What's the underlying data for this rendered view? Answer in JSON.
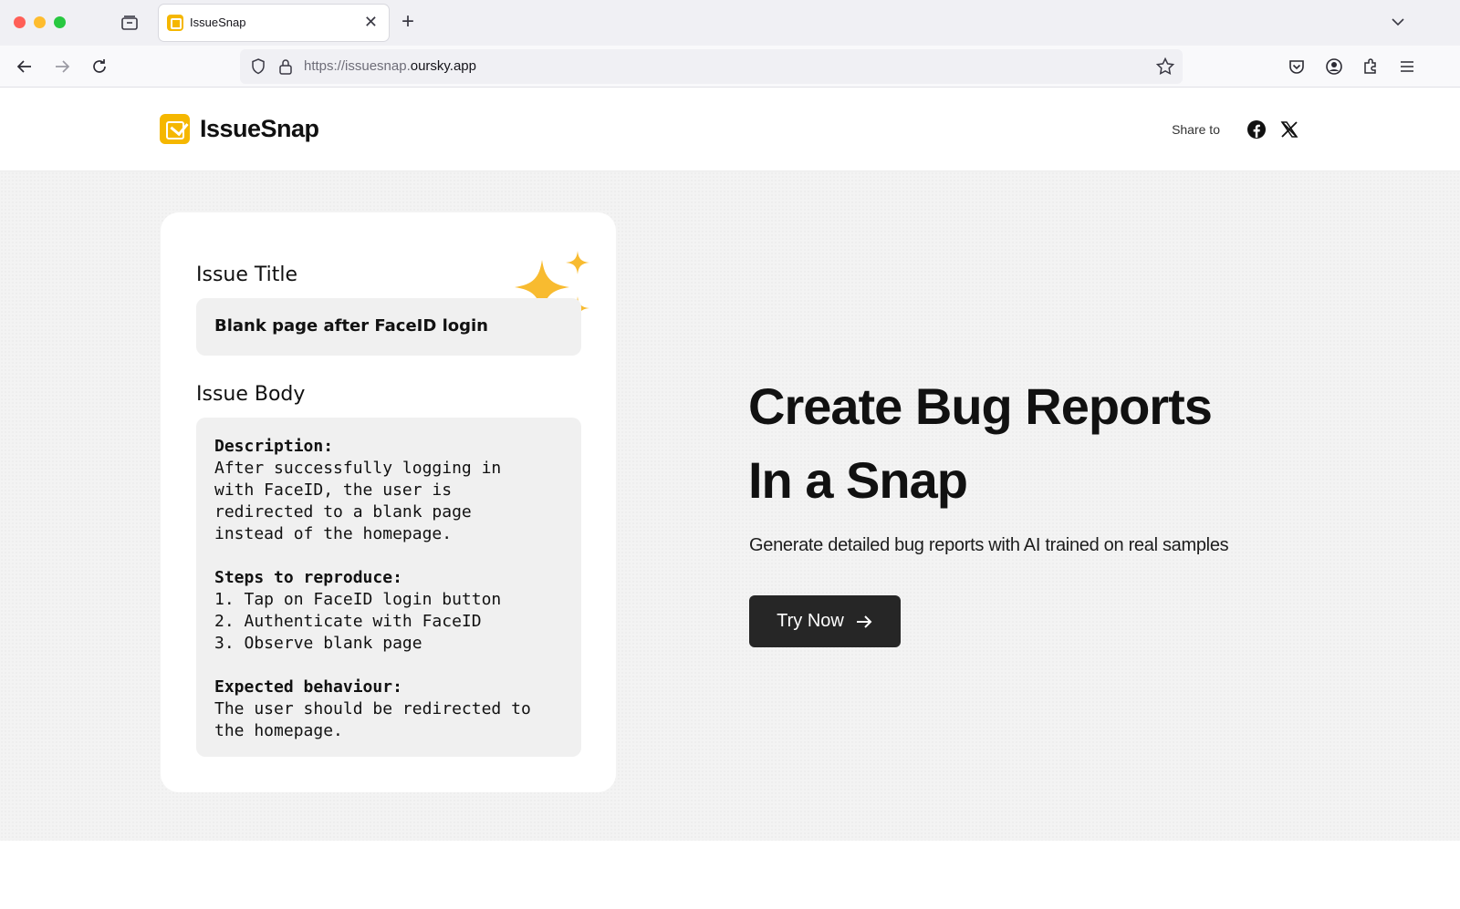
{
  "browser": {
    "tab_title": "IssueSnap",
    "tab_close": "✕",
    "new_tab": "+",
    "url_prefix": "https://issuesnap.",
    "url_domain": "oursky.app"
  },
  "header": {
    "logo_text": "IssueSnap",
    "share_label": "Share to",
    "share_targets": [
      "facebook-icon",
      "x-icon"
    ]
  },
  "card": {
    "title_label": "Issue Title",
    "title_value": "Blank page after FaceID login",
    "body_label": "Issue Body",
    "sections": [
      {
        "heading": "Description:",
        "lines": [
          "After successfully logging in",
          "with FaceID, the user is",
          "redirected to a blank page",
          "instead of the homepage."
        ]
      },
      {
        "heading": "Steps to reproduce:",
        "lines": [
          "1. Tap on FaceID login button",
          "2. Authenticate with FaceID",
          "3. Observe blank page"
        ]
      },
      {
        "heading": "Expected behaviour:",
        "lines": [
          "The user should be redirected to",
          "the homepage."
        ]
      }
    ]
  },
  "hero": {
    "headline_line1": "Create Bug Reports",
    "headline_line2": "In a Snap",
    "subline": "Generate detailed bug reports with AI trained on real samples",
    "cta_label": "Try Now"
  },
  "colors": {
    "brand_yellow": "#f5b700",
    "sparkle_yellow": "#f8bb30",
    "cta_bg": "#262626"
  }
}
